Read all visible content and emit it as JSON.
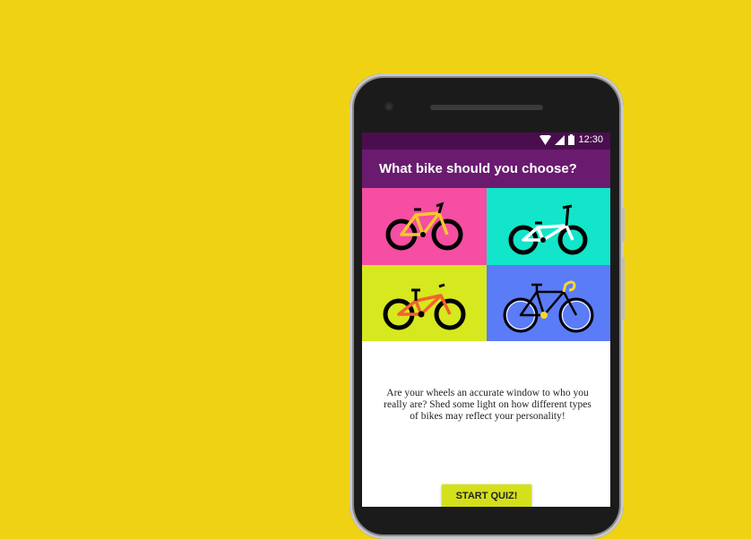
{
  "status_bar": {
    "time": "12:30",
    "icons": [
      "wifi-icon",
      "signal-icon",
      "battery-icon"
    ]
  },
  "app_bar": {
    "title": "What bike should you choose?"
  },
  "bikes": [
    {
      "name": "pink-mountain-bike",
      "tile_color": "#F54EA2",
      "frame_color": "#F7C72B"
    },
    {
      "name": "cyan-bmx-bike",
      "tile_color": "#12E5C9",
      "frame_color": "#FFFFFF"
    },
    {
      "name": "lime-full-suspension-bike",
      "tile_color": "#D6E81E",
      "frame_color": "#F4622F"
    },
    {
      "name": "blue-road-bike",
      "tile_color": "#5B7CF7",
      "frame_color": "#000000"
    }
  ],
  "description": "Are your wheels an accurate window to who you really are? Shed some light on how different types of bikes may reflect your personality!",
  "quiz_button_label": "START QUIZ!",
  "colors": {
    "background": "#F0D214",
    "status_bar": "#4A0E4E",
    "app_bar": "#6A1B6F",
    "button": "#D4E01C"
  }
}
